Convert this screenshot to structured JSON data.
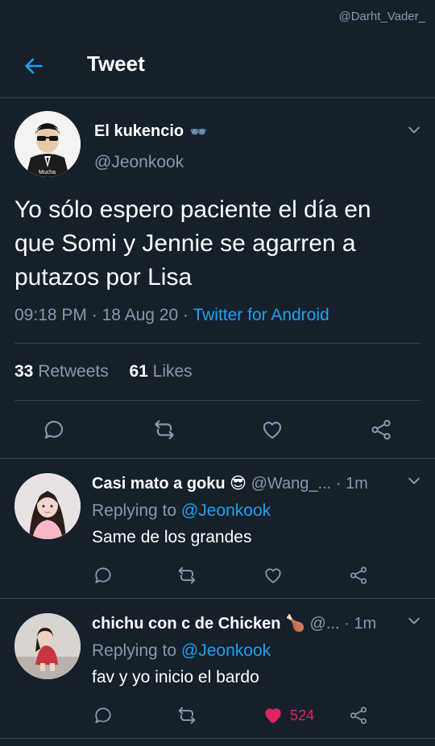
{
  "watermark": "@Darht_Vader_",
  "header": {
    "title": "Tweet",
    "back_icon": "arrow-left-icon"
  },
  "tweet": {
    "author_name": "El kukencio",
    "author_emoji": "🕶",
    "handle": "@Jeonkook",
    "avatar_caption": "Mucha",
    "text": "Yo sólo espero paciente el día en que Somi y Jennie se agarren a putazos por Lisa",
    "time": "09:18 PM",
    "date": "18 Aug 20",
    "source": "Twitter for Android",
    "retweets_count": "33",
    "retweets_label": "Retweets",
    "likes_count": "61",
    "likes_label": "Likes"
  },
  "replies": [
    {
      "name": "Casi mato a goku",
      "name_emoji": "😎",
      "handle": "@Wang_...",
      "time": "1m",
      "replying_label": "Replying to",
      "replying_to": "@Jeonkook",
      "text": "Same de los grandes",
      "liked": false,
      "like_count": ""
    },
    {
      "name": "chichu con c de Chicken",
      "name_emoji": "🍗",
      "handle": "@...",
      "time": "1m",
      "replying_label": "Replying to",
      "replying_to": "@Jeonkook",
      "text": "fav y yo inicio el bardo",
      "liked": true,
      "like_count": "524"
    }
  ],
  "colors": {
    "background": "#15202b",
    "accent": "#1da1f2",
    "muted": "#8899a6",
    "like": "#e0245e",
    "divider": "#38444d"
  }
}
